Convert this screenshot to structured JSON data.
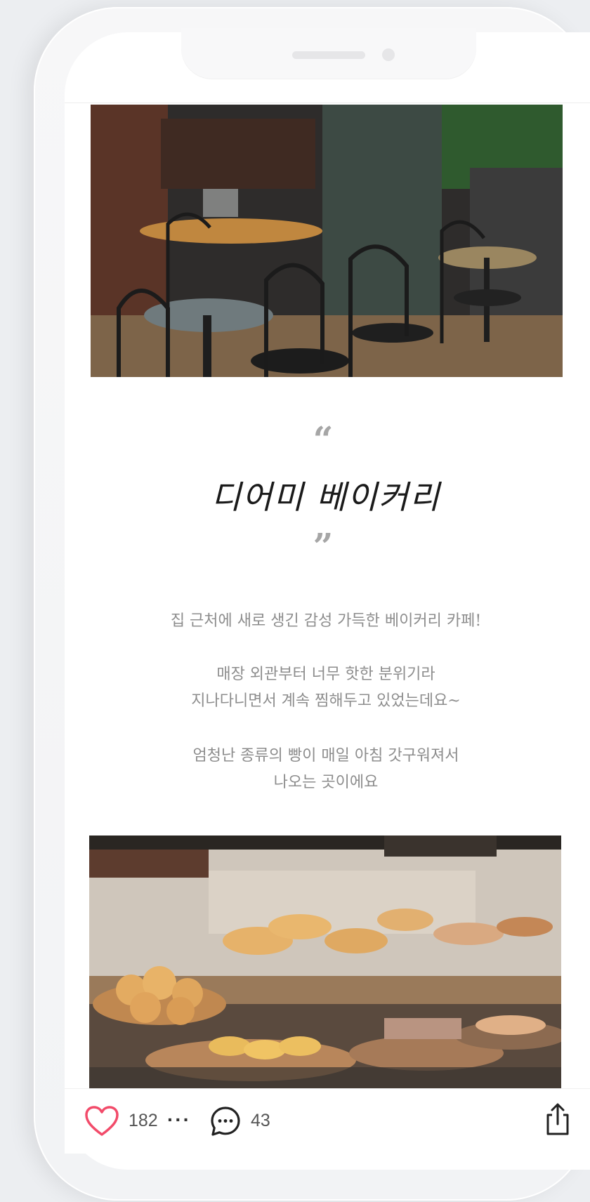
{
  "post": {
    "quote_open": "“",
    "title": "디어미 베이커리",
    "quote_close": "”",
    "paragraph_1": "집 근처에 새로 생긴 감성 가득한 베이커리 카페!",
    "paragraph_2": [
      "매장 외관부터 너무 핫한 분위기라",
      "지나다니면서 계속 찜해두고 있었는데요~"
    ],
    "paragraph_3": [
      "엄청난 종류의 빵이 매일 아침 갓구워져서",
      "나오는 곳이에요"
    ]
  },
  "images": {
    "cafe_photo": "cafe-interior-photo",
    "bakery_photo": "bakery-display-photo"
  },
  "actions": {
    "likes": "182",
    "more": "···",
    "comments": "43",
    "like_icon": "heart-icon",
    "comment_icon": "comment-bubble-icon",
    "share_icon": "share-icon"
  },
  "colors": {
    "like_red": "#f24b6a",
    "body_text": "#8d8d8d",
    "title_text": "#1a1a1a"
  }
}
